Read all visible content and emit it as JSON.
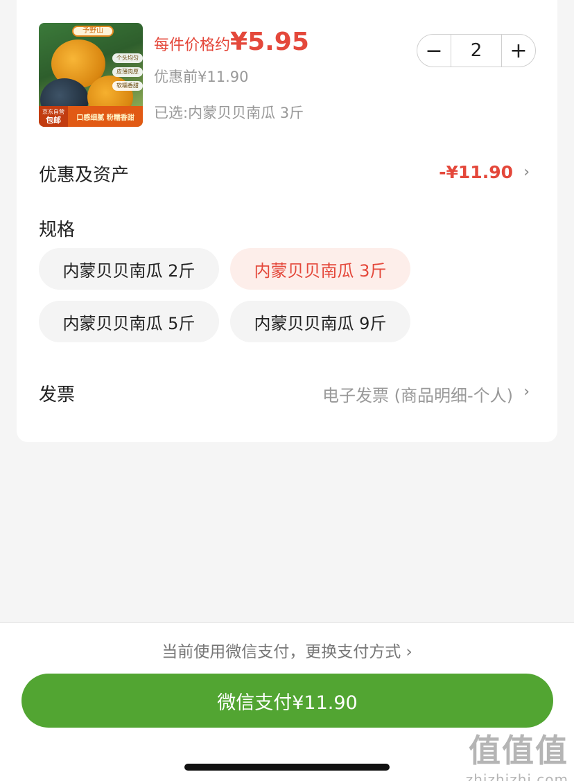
{
  "product": {
    "image_alt": "pumpkin-product-image",
    "image_brand": "予野山",
    "image_tags": [
      "个头均匀",
      "皮薄肉厚",
      "软糯香甜"
    ],
    "image_badge_top": "京东自营",
    "image_badge_bottom": "包邮",
    "image_slogan": "口感细腻 粉糯香甜",
    "price_prefix": "每件价格约",
    "price": "¥5.95",
    "original_price": "优惠前¥11.90",
    "selected": "已选:内蒙贝贝南瓜 3斤"
  },
  "quantity": {
    "minus_label": "−",
    "value": "2",
    "plus_label": "+"
  },
  "discount": {
    "label": "优惠及资产",
    "value": "-¥11.90",
    "chevron": "›"
  },
  "spec": {
    "label": "规格",
    "options": [
      {
        "label": "内蒙贝贝南瓜 2斤",
        "selected": false
      },
      {
        "label": "内蒙贝贝南瓜 3斤",
        "selected": true
      },
      {
        "label": "内蒙贝贝南瓜 5斤",
        "selected": false
      },
      {
        "label": "内蒙贝贝南瓜 9斤",
        "selected": false
      }
    ]
  },
  "invoice": {
    "label": "发票",
    "value": "电子发票 (商品明细-个人)",
    "chevron": "›"
  },
  "payment": {
    "method_text": "当前使用微信支付，更换支付方式 ›",
    "button_label": "微信支付¥11.90"
  },
  "watermark": {
    "logo": "值值值",
    "site": "zhizhizhi.com"
  },
  "colors": {
    "accent_red": "#e4483b",
    "pay_green": "#52a532"
  }
}
